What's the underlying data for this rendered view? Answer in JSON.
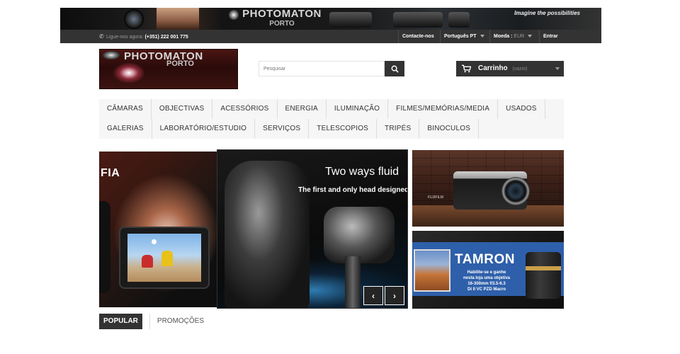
{
  "top_banner": {
    "brand_line1": "PHOTOMATON",
    "brand_line2": "PORTO",
    "slogan": "Imagine the possibilities"
  },
  "top_nav": {
    "phone_label": "Ligue-nos agora:",
    "phone_number": "(+351) 222 001 775",
    "contact": "Contacte-nos",
    "language": "Português PT",
    "currency_label": "Moeda :",
    "currency_value": "EUR",
    "login": "Entrar"
  },
  "header": {
    "logo_line1": "PHOTOMATON",
    "logo_line2": "PORTO",
    "search_placeholder": "Pesquisar",
    "cart_label": "Carrinho",
    "cart_status": "(vazio)"
  },
  "menu": {
    "row1": [
      "CÂMARAS",
      "OBJECTIVAS",
      "ACESSÓRIOS",
      "ENERGIA",
      "ILUMINAÇÃO",
      "FILMES/MEMÓRIAS/MEDIA",
      "USADOS"
    ],
    "row2": [
      "GALERIAS",
      "LABORATÓRIO/ESTUDIO",
      "SERVIÇOS",
      "TELESCOPIOS",
      "TRIPÉS",
      "BINOCULOS"
    ]
  },
  "slider": {
    "left_caption": "FIA",
    "main_headline": "Two ways fluid",
    "main_subline": "The first and only head designed",
    "prev_symbol": "‹",
    "next_symbol": "›"
  },
  "ads": {
    "top_brand": "FUJIFILM",
    "bottom_brand": "TAMRON",
    "bottom_lines": [
      "Habilite-se e ganhe",
      "nesta loja uma objetiva",
      "16-300mm f/3.5-6.3",
      "Di II VC PZD Macro"
    ]
  },
  "tabs": {
    "popular": "POPULAR",
    "promo": "PROMOÇÕES"
  },
  "colors": {
    "dark_bar": "#333333",
    "menu_bg": "#f6f6f6"
  }
}
